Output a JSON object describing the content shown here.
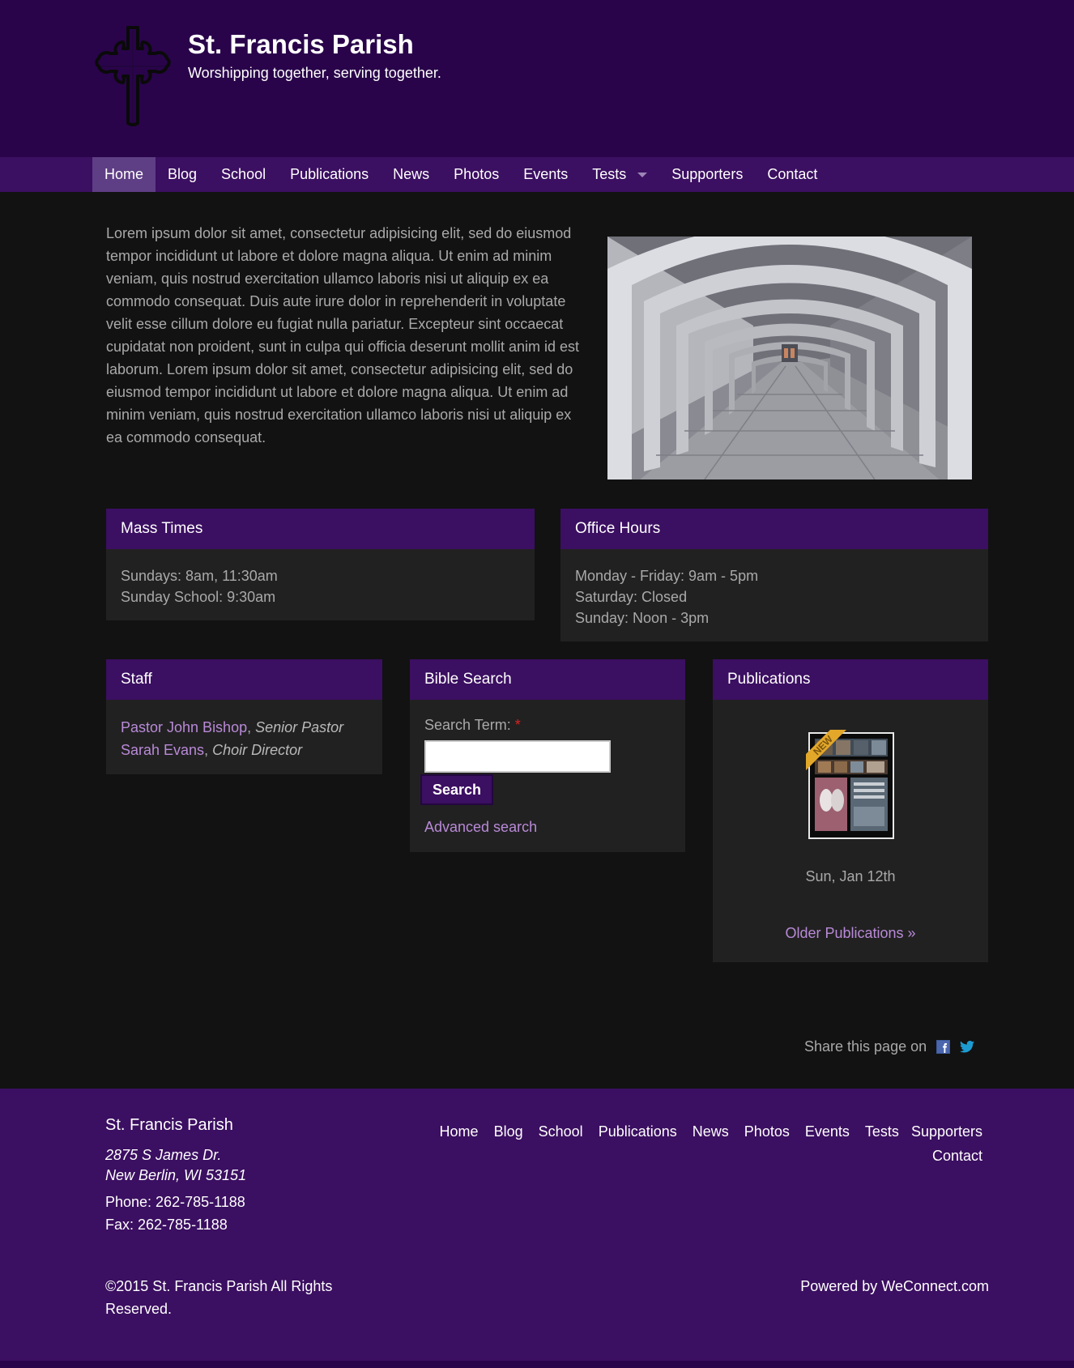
{
  "header": {
    "title": "St. Francis Parish",
    "tagline": "Worshipping together, serving together.",
    "logo_icon": "cross-icon"
  },
  "nav": {
    "items": [
      "Home",
      "Blog",
      "School",
      "Publications",
      "News",
      "Photos",
      "Events",
      "Tests",
      "Supporters",
      "Contact"
    ],
    "active": "Home"
  },
  "intro": {
    "text": "Lorem ipsum dolor sit amet, consectetur adipisicing elit, sed do eiusmod tempor incididunt ut labore et dolore magna aliqua. Ut enim ad minim veniam, quis nostrud exercitation ullamco laboris nisi ut aliquip ex ea commodo consequat. Duis aute irure dolor in reprehenderit in voluptate velit esse cillum dolore eu fugiat nulla pariatur. Excepteur sint occaecat cupidatat non proident, sunt in culpa qui officia deserunt mollit anim id est laborum. Lorem ipsum dolor sit amet, consectetur adipisicing elit, sed do eiusmod tempor incididunt ut labore et dolore magna aliqua. Ut enim ad minim veniam, quis nostrud exercitation ullamco laboris nisi ut aliquip ex ea commodo consequat."
  },
  "mass_times": {
    "title": "Mass Times",
    "lines": [
      "Sundays: 8am, 11:30am",
      "Sunday School: 9:30am"
    ]
  },
  "office_hours": {
    "title": "Office Hours",
    "lines": [
      "Monday - Friday: 9am - 5pm",
      "Saturday: Closed",
      "Sunday: Noon - 3pm"
    ]
  },
  "staff": {
    "title": "Staff",
    "members": [
      {
        "name": "Pastor John Bishop",
        "role": "Senior Pastor"
      },
      {
        "name": "Sarah Evans",
        "role": "Choir Director"
      }
    ]
  },
  "bible_search": {
    "title": "Bible Search",
    "label": "Search Term:",
    "required_mark": "*",
    "input_value": "",
    "button": "Search",
    "advanced_link": "Advanced search"
  },
  "publications": {
    "title": "Publications",
    "badge": "NEW",
    "date": "Sun, Jan 12th",
    "older_link": "Older Publications »"
  },
  "share": {
    "label": "Share this page on",
    "icons": [
      "facebook-icon",
      "twitter-icon"
    ]
  },
  "footer": {
    "name": "St. Francis Parish",
    "address_line1": "2875 S James Dr.",
    "address_line2": "New Berlin, WI 53151",
    "phone": "Phone: 262-785-1188",
    "fax": "Fax: 262-785-1188",
    "nav": [
      "Home",
      "Blog",
      "School",
      "Publications",
      "News",
      "Photos",
      "Events",
      "Tests",
      "Supporters",
      "Contact"
    ],
    "copyright": "©2015 St. Francis Parish All Rights Reserved.",
    "powered_by": "Powered by WeConnect.com"
  },
  "colors": {
    "header_bg": "#29044a",
    "nav_bg": "#3b0f61",
    "nav_active": "#5e3e84",
    "page_bg": "#121212",
    "panel_bg": "#212121",
    "link": "#b98ad8"
  }
}
